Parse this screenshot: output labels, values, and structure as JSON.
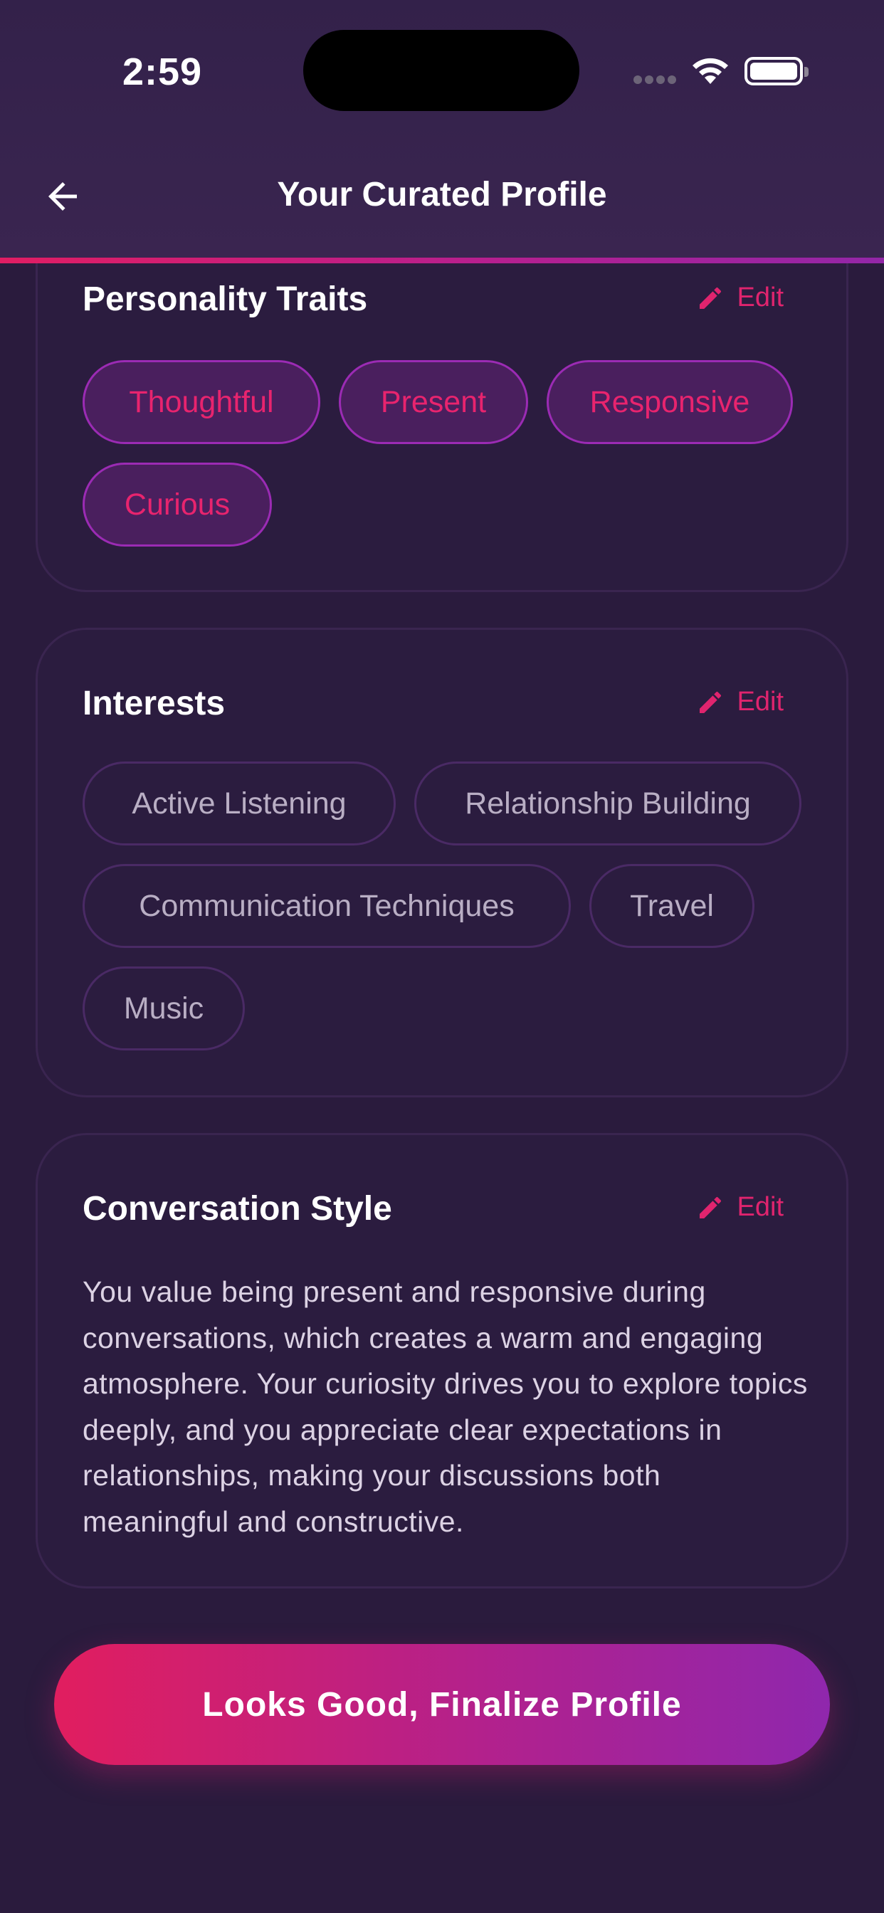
{
  "status_bar": {
    "time": "2:59"
  },
  "header": {
    "title": "Your Curated Profile",
    "back_icon": "arrow-left-icon"
  },
  "sections": {
    "personality": {
      "title": "Personality Traits",
      "edit_label": "Edit",
      "chips": [
        "Thoughtful",
        "Present",
        "Responsive",
        "Curious"
      ]
    },
    "interests": {
      "title": "Interests",
      "edit_label": "Edit",
      "chips": [
        "Active Listening",
        "Relationship Building",
        "Communication Techniques",
        "Travel",
        "Music"
      ]
    },
    "conversation_style": {
      "title": "Conversation Style",
      "edit_label": "Edit",
      "text": "You value being present and responsive during conversations, which creates a warm and engaging atmosphere. Your curiosity drives you to explore topics deeply, and you appreciate clear expectations in relationships, making your discussions both meaningful and constructive."
    }
  },
  "cta": {
    "label": "Looks Good, Finalize Profile"
  },
  "colors": {
    "background": "#2a1b3d",
    "accent_pink": "#e0246e",
    "accent_purple": "#8f27ad",
    "chip_border": "#9b2bb4"
  }
}
